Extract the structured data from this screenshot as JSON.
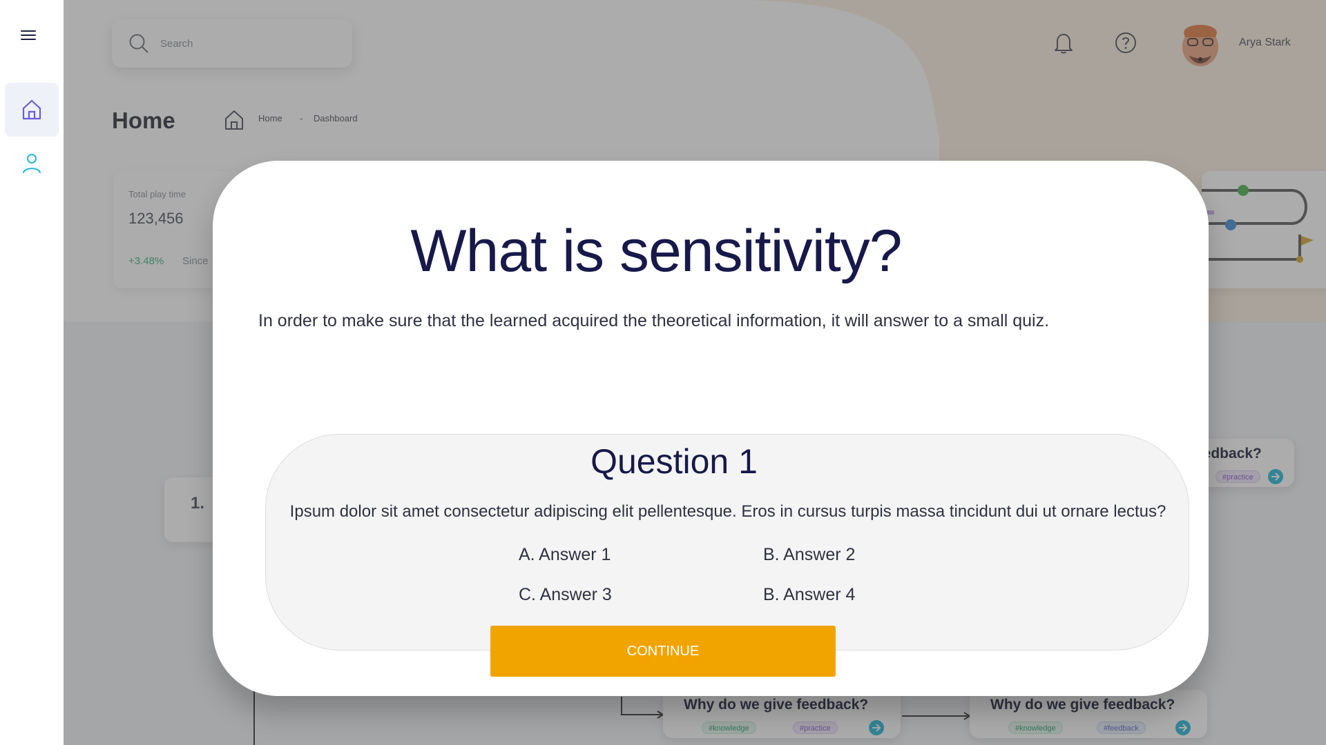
{
  "header": {
    "search_placeholder": "Search",
    "user_name": "Arya Stark"
  },
  "page": {
    "title": "Home",
    "breadcrumb": [
      "Home",
      "-",
      "Dashboard"
    ]
  },
  "stat_card": {
    "label": "Total play time",
    "value": "123,456",
    "delta": "+3.48%",
    "since": "Since"
  },
  "flow": {
    "step_number": "1.",
    "cards": [
      {
        "title": "eedback?",
        "tags": [
          "#practice"
        ]
      },
      {
        "title": "Why do we give feedback?",
        "tags": [
          "#knowledge",
          "#practice"
        ]
      },
      {
        "title": "Why do we give feedback?",
        "tags": [
          "#knowledge",
          "#feedback"
        ]
      }
    ]
  },
  "modal": {
    "title": "What is sensitivity?",
    "description": "In order to make sure that the learned acquired the theoretical information, it will answer to a small quiz.",
    "question": {
      "title": "Question 1",
      "text": "Ipsum dolor sit amet consectetur adipiscing elit pellentesque. Eros in cursus turpis massa tincidunt dui ut ornare lectus?",
      "answers": [
        "A. Answer 1",
        "B. Answer 2",
        "C. Answer 3",
        "B. Answer 4"
      ]
    },
    "continue_label": "CONTINUE"
  },
  "colors": {
    "accent": "#f1a400",
    "title_navy": "#17194a",
    "teal": "#23b7d8"
  }
}
